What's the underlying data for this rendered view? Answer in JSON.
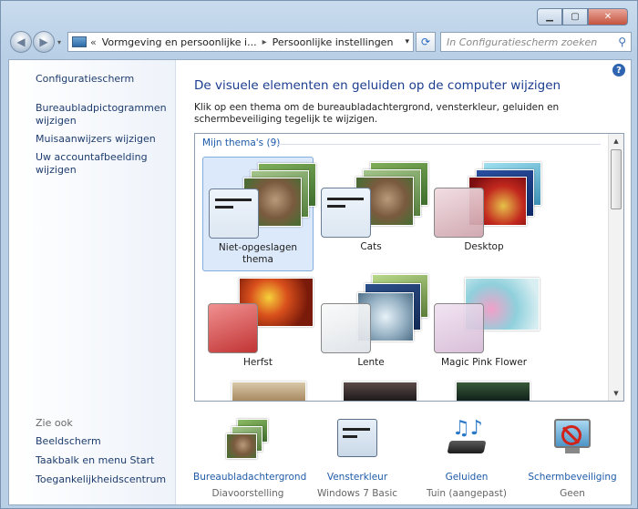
{
  "window": {
    "min": "▁",
    "max": "▢",
    "close": "✕"
  },
  "nav": {
    "back": "◀",
    "forward": "▶",
    "dropdown": "▾",
    "breadcrumb": [
      "«",
      "Vormgeving en persoonlijke i...",
      "Persoonlijke instellingen"
    ],
    "address_dd": "▾",
    "refresh": "⟳",
    "search_placeholder": "In Configuratiescherm zoeken",
    "search_icon": "⚲"
  },
  "left": {
    "home": "Configuratiescherm",
    "links": [
      "Bureaubladpictogrammen wijzigen",
      "Muisaanwijzers wijzigen",
      "Uw accountafbeelding wijzigen"
    ],
    "see_also": "Zie ook",
    "see_links": [
      "Beeldscherm",
      "Taakbalk en menu Start",
      "Toegankelijkheidscentrum"
    ]
  },
  "main": {
    "help": "?",
    "heading": "De visuele elementen en geluiden op de computer wijzigen",
    "description": "Klik op een thema om de bureaubladachtergrond, vensterkleur, geluiden en schermbeveiliging tegelijk te wijzigen.",
    "group": "Mijn thema's (9)",
    "themes": [
      {
        "label": "Niet-opgeslagen thema",
        "selected": true
      },
      {
        "label": "Cats",
        "selected": false
      },
      {
        "label": "Desktop",
        "selected": false
      },
      {
        "label": "Herfst",
        "selected": false
      },
      {
        "label": "Lente",
        "selected": false
      },
      {
        "label": "Magic Pink Flower",
        "selected": false
      }
    ],
    "scroll_up": "▲",
    "scroll_down": "▼"
  },
  "bottom": [
    {
      "title": "Bureaubladachtergrond",
      "sub": "Diavoorstelling",
      "icon": "wallpaper-icon"
    },
    {
      "title": "Vensterkleur",
      "sub": "Windows 7 Basic",
      "icon": "window-color-icon"
    },
    {
      "title": "Geluiden",
      "sub": "Tuin (aangepast)",
      "icon": "sounds-icon"
    },
    {
      "title": "Schermbeveiliging",
      "sub": "Geen",
      "icon": "screensaver-icon"
    }
  ],
  "colors": {
    "accent": "#1e5aa8",
    "heading": "#1a3d8f",
    "selection": "#dbe9fa"
  }
}
